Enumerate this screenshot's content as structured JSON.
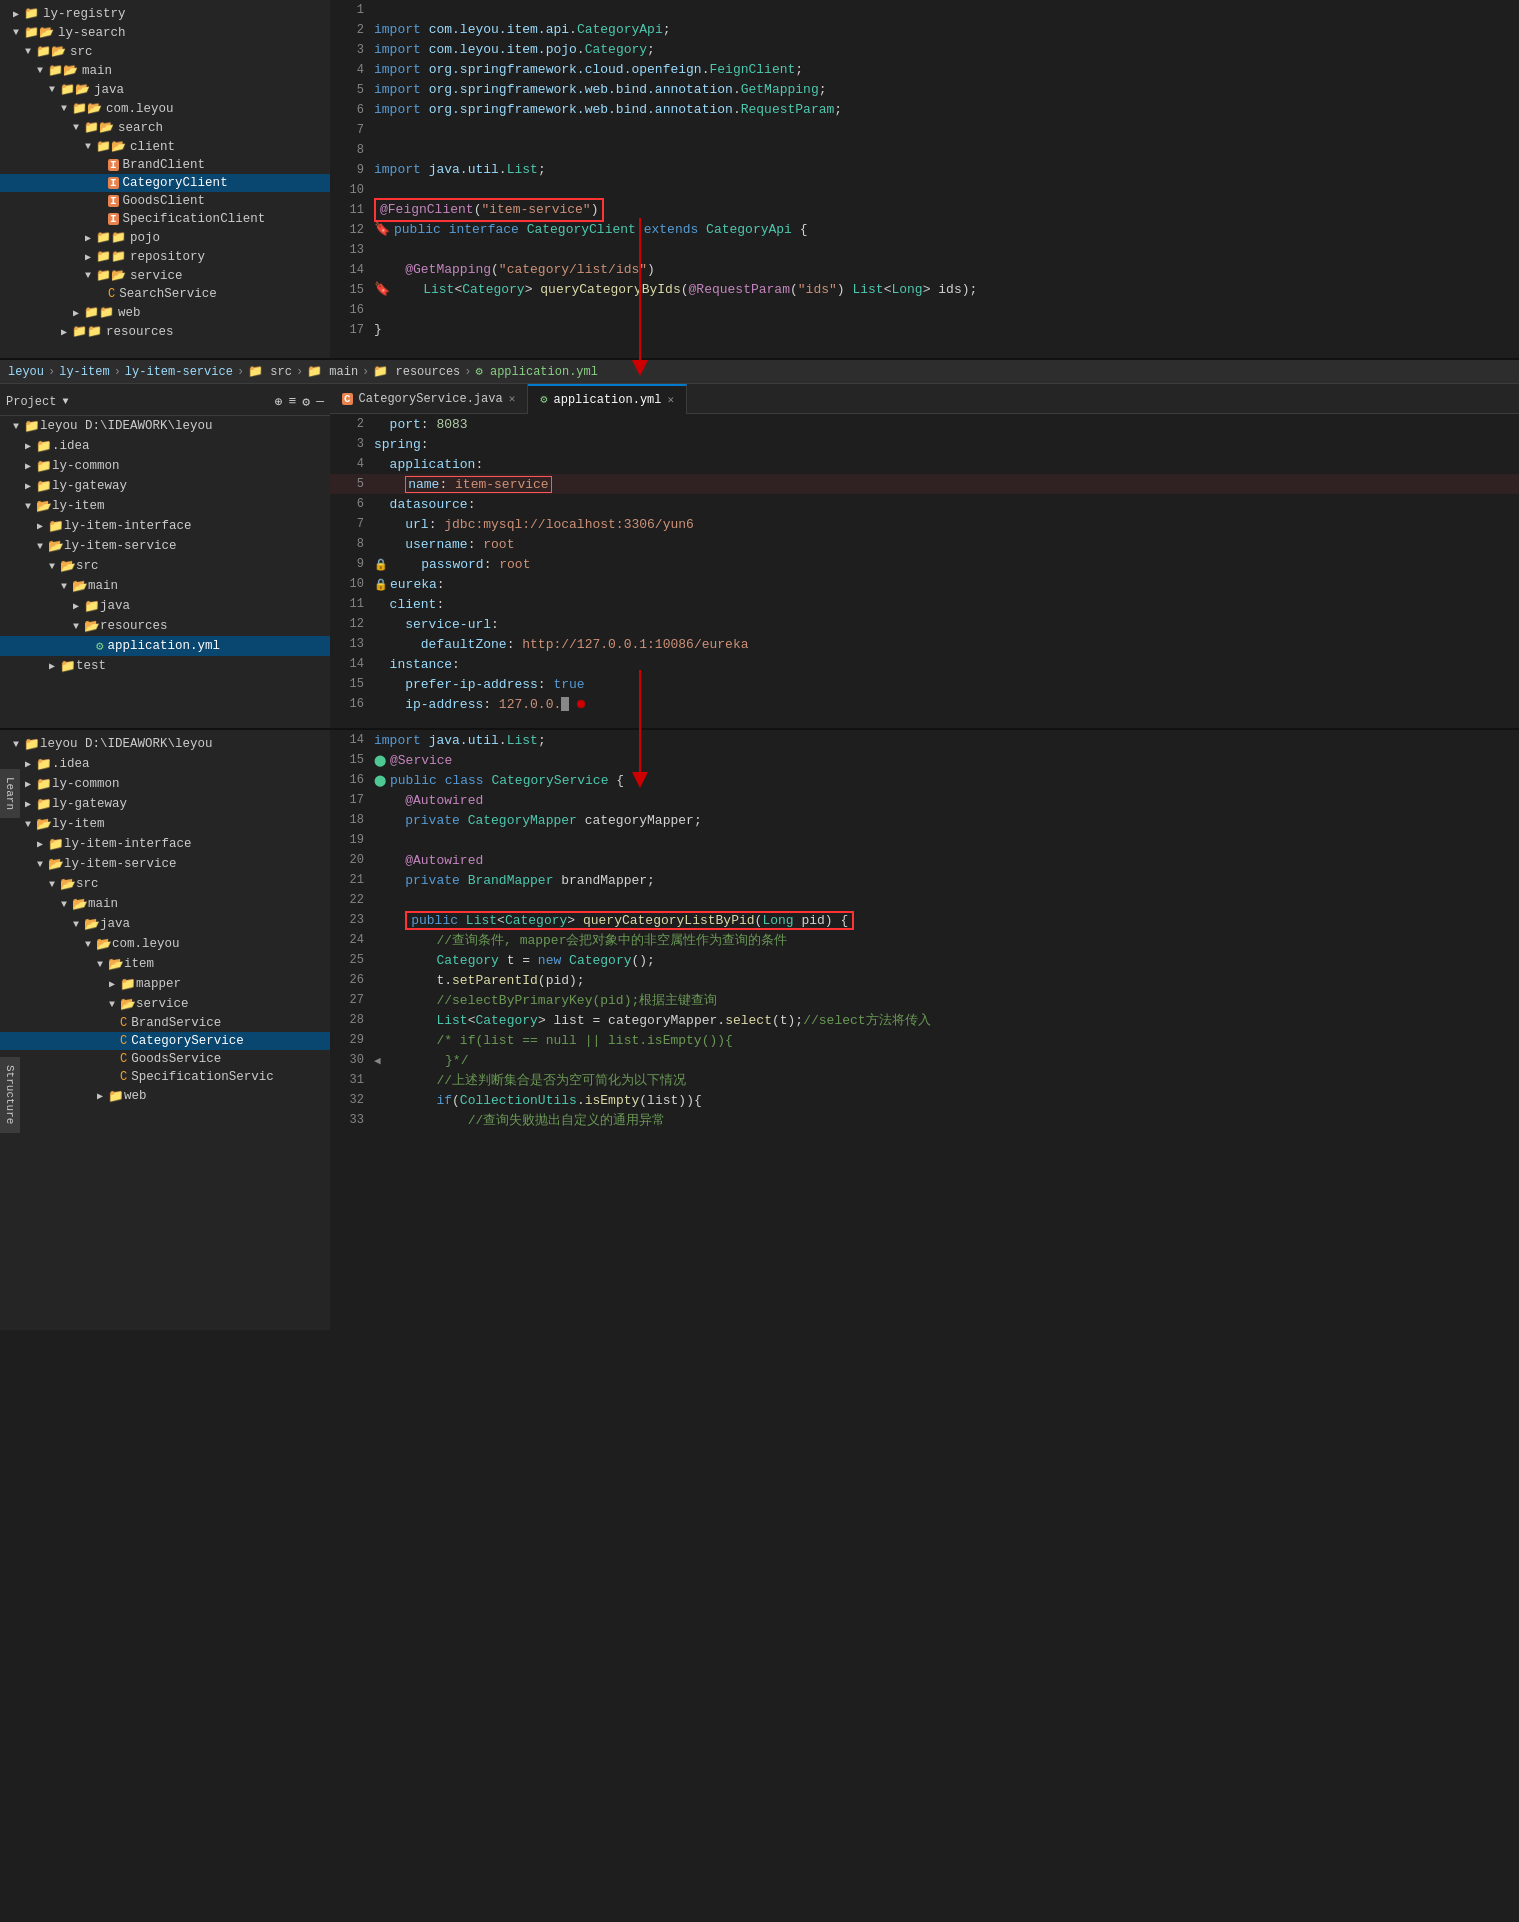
{
  "panels": {
    "panel1": {
      "sidebar": {
        "items": [
          {
            "indent": 1,
            "type": "dir",
            "arrow": "right",
            "label": "ly-registry",
            "icon": "folder"
          },
          {
            "indent": 1,
            "type": "dir",
            "arrow": "down",
            "label": "ly-search",
            "icon": "folder-open",
            "selected": true
          },
          {
            "indent": 2,
            "type": "dir",
            "arrow": "down",
            "label": "src",
            "icon": "folder-open"
          },
          {
            "indent": 3,
            "type": "dir",
            "arrow": "down",
            "label": "main",
            "icon": "folder-open"
          },
          {
            "indent": 4,
            "type": "dir",
            "arrow": "down",
            "label": "java",
            "icon": "folder-open"
          },
          {
            "indent": 5,
            "type": "dir",
            "arrow": "down",
            "label": "com.leyou",
            "icon": "folder-open"
          },
          {
            "indent": 6,
            "type": "dir",
            "arrow": "down",
            "label": "search",
            "icon": "folder-open"
          },
          {
            "indent": 7,
            "type": "dir",
            "arrow": "down",
            "label": "client",
            "icon": "folder-open"
          },
          {
            "indent": 8,
            "type": "java",
            "label": "BrandClient"
          },
          {
            "indent": 8,
            "type": "java",
            "label": "CategoryClient",
            "selected": true
          },
          {
            "indent": 8,
            "type": "java",
            "label": "GoodsClient"
          },
          {
            "indent": 8,
            "type": "java",
            "label": "SpecificationClient"
          },
          {
            "indent": 7,
            "type": "dir",
            "arrow": "right",
            "label": "pojo",
            "icon": "folder"
          },
          {
            "indent": 7,
            "type": "dir",
            "arrow": "right",
            "label": "repository",
            "icon": "folder"
          },
          {
            "indent": 7,
            "type": "dir",
            "arrow": "down",
            "label": "service",
            "icon": "folder-open"
          },
          {
            "indent": 8,
            "type": "java",
            "label": "SearchService"
          },
          {
            "indent": 6,
            "type": "dir",
            "arrow": "right",
            "label": "web",
            "icon": "folder"
          },
          {
            "indent": 5,
            "type": "dir",
            "arrow": "right",
            "label": "resources",
            "icon": "folder"
          }
        ]
      },
      "editor": {
        "lines": [
          {
            "ln": 1,
            "code": ""
          },
          {
            "ln": 2,
            "code": "import com.leyou.item.api.CategoryApi;"
          },
          {
            "ln": 3,
            "code": "import com.leyou.item.pojo.Category;"
          },
          {
            "ln": 4,
            "code": "import org.springframework.cloud.openfeign.FeignClient;"
          },
          {
            "ln": 5,
            "code": "import org.springframework.web.bind.annotation.GetMapping;"
          },
          {
            "ln": 6,
            "code": "import org.springframework.web.bind.annotation.RequestParam;"
          },
          {
            "ln": 7,
            "code": ""
          },
          {
            "ln": 8,
            "code": ""
          },
          {
            "ln": 9,
            "code": "import java.util.List;"
          },
          {
            "ln": 10,
            "code": ""
          },
          {
            "ln": 11,
            "code": "@FeignClient(\"item-service\")",
            "highlight": true
          },
          {
            "ln": 12,
            "code": "public interface CategoryClient extends CategoryApi {"
          },
          {
            "ln": 13,
            "code": ""
          },
          {
            "ln": 14,
            "code": "    @GetMapping(\"category/list/ids\")"
          },
          {
            "ln": 15,
            "code": "    List<Category> queryCategoryByIds(@RequestParam(\"ids\") List<Long> ids);"
          },
          {
            "ln": 16,
            "code": ""
          },
          {
            "ln": 17,
            "code": "}"
          }
        ]
      }
    },
    "panel2": {
      "breadcrumb": [
        "leyou",
        "ly-item",
        "ly-item-service",
        "src",
        "main",
        "resources",
        "application.yml"
      ],
      "tabs": [
        {
          "label": "CategoryService.java",
          "icon": "java",
          "active": false
        },
        {
          "label": "application.yml",
          "icon": "yaml",
          "active": true
        }
      ],
      "toolbar": {
        "label": "Project",
        "icons": [
          "+",
          "≡",
          "⚙",
          "—"
        ]
      },
      "sidebar": {
        "items": [
          {
            "indent": 1,
            "type": "dir",
            "arrow": "down",
            "label": "leyou D:\\IDEAWORK\\leyou"
          },
          {
            "indent": 2,
            "type": "dir",
            "arrow": "right",
            "label": ".idea"
          },
          {
            "indent": 2,
            "type": "dir",
            "arrow": "right",
            "label": "ly-common"
          },
          {
            "indent": 2,
            "type": "dir",
            "arrow": "right",
            "label": "ly-gateway"
          },
          {
            "indent": 2,
            "type": "dir",
            "arrow": "down",
            "label": "ly-item"
          },
          {
            "indent": 3,
            "type": "dir",
            "arrow": "right",
            "label": "ly-item-interface"
          },
          {
            "indent": 3,
            "type": "dir",
            "arrow": "down",
            "label": "ly-item-service"
          },
          {
            "indent": 4,
            "type": "dir",
            "arrow": "down",
            "label": "src"
          },
          {
            "indent": 5,
            "type": "dir",
            "arrow": "down",
            "label": "main"
          },
          {
            "indent": 6,
            "type": "dir",
            "arrow": "right",
            "label": "java"
          },
          {
            "indent": 6,
            "type": "dir",
            "arrow": "down",
            "label": "resources"
          },
          {
            "indent": 7,
            "type": "yaml",
            "label": "application.yml",
            "selected": true
          },
          {
            "indent": 4,
            "type": "dir",
            "arrow": "right",
            "label": "test"
          }
        ]
      },
      "editor": {
        "lines": [
          {
            "ln": 2,
            "code": "  port: 8083"
          },
          {
            "ln": 3,
            "code": "spring:"
          },
          {
            "ln": 4,
            "code": "  application:"
          },
          {
            "ln": 5,
            "code": "    name: item-service",
            "highlight": true
          },
          {
            "ln": 6,
            "code": "  datasource:"
          },
          {
            "ln": 7,
            "code": "    url: jdbc:mysql://localhost:3306/yun6"
          },
          {
            "ln": 8,
            "code": "    username: root"
          },
          {
            "ln": 9,
            "code": "    password: root"
          },
          {
            "ln": 10,
            "code": "  eureka:"
          },
          {
            "ln": 11,
            "code": "  client:"
          },
          {
            "ln": 12,
            "code": "    service-url:"
          },
          {
            "ln": 13,
            "code": "      defaultZone: http://127.0.0.1:10086/eureka"
          },
          {
            "ln": 14,
            "code": "  instance:"
          },
          {
            "ln": 15,
            "code": "    prefer-ip-address: true"
          },
          {
            "ln": 16,
            "code": "    ip-address: 127.0.0."
          }
        ]
      }
    },
    "panel3": {
      "sidebar": {
        "items": [
          {
            "indent": 1,
            "type": "dir",
            "arrow": "down",
            "label": "leyou D:\\IDEAWORK\\leyou"
          },
          {
            "indent": 2,
            "type": "dir",
            "arrow": "right",
            "label": ".idea"
          },
          {
            "indent": 2,
            "type": "dir",
            "arrow": "right",
            "label": "ly-common"
          },
          {
            "indent": 2,
            "type": "dir",
            "arrow": "right",
            "label": "ly-gateway"
          },
          {
            "indent": 2,
            "type": "dir",
            "arrow": "down",
            "label": "ly-item"
          },
          {
            "indent": 3,
            "type": "dir",
            "arrow": "right",
            "label": "ly-item-interface"
          },
          {
            "indent": 3,
            "type": "dir",
            "arrow": "down",
            "label": "ly-item-service"
          },
          {
            "indent": 4,
            "type": "dir",
            "arrow": "down",
            "label": "src"
          },
          {
            "indent": 5,
            "type": "dir",
            "arrow": "down",
            "label": "main"
          },
          {
            "indent": 6,
            "type": "dir",
            "arrow": "down",
            "label": "java"
          },
          {
            "indent": 7,
            "type": "dir",
            "arrow": "down",
            "label": "com.leyou"
          },
          {
            "indent": 8,
            "type": "dir",
            "arrow": "down",
            "label": "item"
          },
          {
            "indent": 9,
            "type": "dir",
            "arrow": "right",
            "label": "mapper"
          },
          {
            "indent": 9,
            "type": "dir",
            "arrow": "down",
            "label": "service"
          },
          {
            "indent": 10,
            "type": "java",
            "label": "BrandService"
          },
          {
            "indent": 10,
            "type": "java",
            "label": "CategoryService",
            "selected": true
          },
          {
            "indent": 10,
            "type": "java",
            "label": "GoodsService"
          },
          {
            "indent": 10,
            "type": "java",
            "label": "SpecificationServic"
          },
          {
            "indent": 8,
            "type": "dir",
            "arrow": "right",
            "label": "web"
          }
        ]
      },
      "editor": {
        "lines": [
          {
            "ln": 14,
            "code": "import java.util.List;"
          },
          {
            "ln": 15,
            "code": "@Service"
          },
          {
            "ln": 16,
            "code": "public class CategoryService {"
          },
          {
            "ln": 17,
            "code": "    @Autowired"
          },
          {
            "ln": 18,
            "code": "    private CategoryMapper categoryMapper;"
          },
          {
            "ln": 19,
            "code": ""
          },
          {
            "ln": 20,
            "code": "    @Autowired"
          },
          {
            "ln": 21,
            "code": "    private BrandMapper brandMapper;"
          },
          {
            "ln": 22,
            "code": ""
          },
          {
            "ln": 23,
            "code": "    public List<Category> queryCategoryListByPid(Long pid) {",
            "highlight": true
          },
          {
            "ln": 24,
            "code": "        //查询条件, mapper会把对象中的非空属性作为查询的条件"
          },
          {
            "ln": 25,
            "code": "        Category t = new Category();"
          },
          {
            "ln": 26,
            "code": "        t.setParentId(pid);"
          },
          {
            "ln": 27,
            "code": "        //selectByPrimaryKey(pid);根据主键查询"
          },
          {
            "ln": 28,
            "code": "        List<Category> list = categoryMapper.select(t);//select方法将传入"
          },
          {
            "ln": 29,
            "code": "        /* if(list == null || list.isEmpty()){"
          },
          {
            "ln": 30,
            "code": "        }*/"
          },
          {
            "ln": 31,
            "code": "        //上述判断集合是否为空可简化为以下情况"
          },
          {
            "ln": 32,
            "code": "        if(CollectionUtils.isEmpty(list)){"
          },
          {
            "ln": 33,
            "code": "            //查询失败抛出自定义的通用异常"
          }
        ]
      }
    }
  },
  "left_tabs": {
    "learn": "Learn",
    "structure": "Structure"
  },
  "colors": {
    "highlight_border": "#ff4444",
    "selected_bg": "#094771",
    "active_tab_border": "#007acc"
  }
}
